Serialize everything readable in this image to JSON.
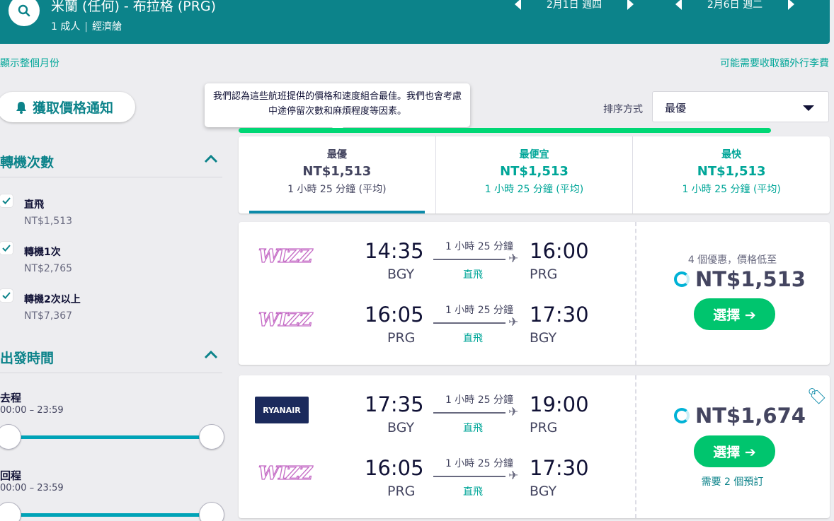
{
  "header": {
    "route_title": "米蘭 (任何) - 布拉格 (PRG)",
    "passengers": "1 成人",
    "cabin": "經濟艙",
    "outbound_date": "2月1日 週四",
    "return_date": "2月6日 週二"
  },
  "links": {
    "show_month": "顯示整個月份",
    "baggage_fee": "可能需要收取額外行李費"
  },
  "alert_button": "獲取價格通知",
  "filters": {
    "stops_title": "轉機次數",
    "stops": [
      {
        "label": "直飛",
        "price": "NT$1,513"
      },
      {
        "label": "轉機1次",
        "price": "NT$2,765"
      },
      {
        "label": "轉機2次以上",
        "price": "NT$7,367"
      }
    ],
    "depart_title": "出發時間",
    "outbound_label": "去程",
    "outbound_range": "00:00 – 23:59",
    "return_label": "回程",
    "return_range": "00:00 – 23:59"
  },
  "tooltip": "我們認為這些航班提供的價格和速度組合最佳。我們也會考慮中途停留次數和麻煩程度等因素。",
  "sort": {
    "label": "排序方式",
    "value": "最優"
  },
  "progress": 0.9,
  "tabs": [
    {
      "name": "最優",
      "price": "NT$1,513",
      "duration": "1 小時 25 分鐘 (平均)"
    },
    {
      "name": "最便宜",
      "price": "NT$1,513",
      "duration": "1 小時 25 分鐘 (平均)"
    },
    {
      "name": "最快",
      "price": "NT$1,513",
      "duration": "1 小時 25 分鐘 (平均)"
    }
  ],
  "results": [
    {
      "legs": [
        {
          "airline": "WIZZ",
          "dep_time": "14:35",
          "dep_code": "BGY",
          "duration": "1 小時 25 分鐘",
          "stops": "直飛",
          "arr_time": "16:00",
          "arr_code": "PRG"
        },
        {
          "airline": "WIZZ",
          "dep_time": "16:05",
          "dep_code": "PRG",
          "duration": "1 小時 25 分鐘",
          "stops": "直飛",
          "arr_time": "17:30",
          "arr_code": "BGY"
        }
      ],
      "deals": "4 個優惠，價格低至",
      "price": "NT$1,513",
      "select": "選擇 ➔"
    },
    {
      "legs": [
        {
          "airline": "RYANAIR",
          "dep_time": "17:35",
          "dep_code": "BGY",
          "duration": "1 小時 25 分鐘",
          "stops": "直飛",
          "arr_time": "19:00",
          "arr_code": "PRG"
        },
        {
          "airline": "WIZZ",
          "dep_time": "16:05",
          "dep_code": "PRG",
          "duration": "1 小時 25 分鐘",
          "stops": "直飛",
          "arr_time": "17:30",
          "arr_code": "BGY"
        }
      ],
      "price": "NT$1,674",
      "select": "選擇 ➔",
      "needs": "需要 2 個預訂"
    }
  ],
  "colors": {
    "header": "#0c838a",
    "accent": "#00a698",
    "button": "#00c56e"
  }
}
